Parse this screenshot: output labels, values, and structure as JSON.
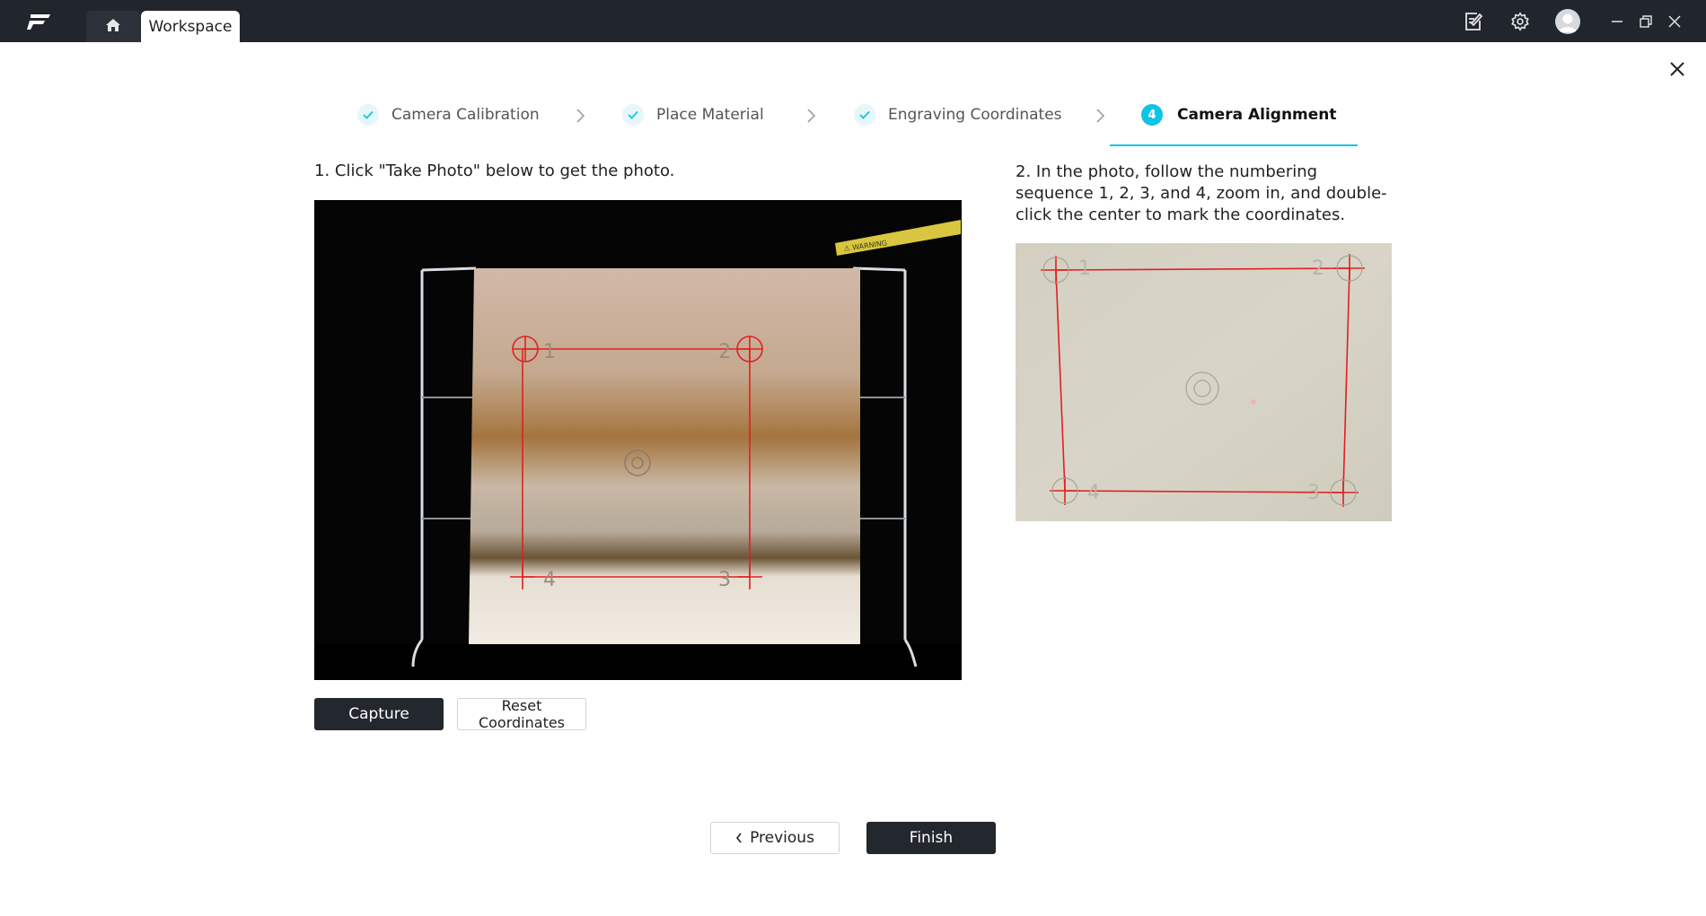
{
  "app": {
    "logo_icon": "f-logo-icon",
    "home_icon": "home-icon",
    "tab_label": "Workspace"
  },
  "titlebar_icons": [
    "notes-edit-icon",
    "gear-icon",
    "avatar-icon",
    "minimize-icon",
    "restore-icon",
    "close-icon"
  ],
  "stepper": {
    "steps": [
      {
        "label": "Camera Calibration",
        "state": "done"
      },
      {
        "label": "Place Material",
        "state": "done"
      },
      {
        "label": "Engraving Coordinates",
        "state": "done"
      },
      {
        "label": "Camera Alignment",
        "state": "active",
        "number": "4"
      }
    ],
    "accent_color": "#0ec4e3"
  },
  "main": {
    "instruction_1": "1. Click \"Take Photo\" below to get the photo.",
    "instruction_2": "2. In the photo, follow the numbering sequence 1, 2, 3, and 4, zoom in, and double-click the center to mark the coordinates.",
    "capture_label": "Capture",
    "reset_label": "Reset Coordinates",
    "photo_marker_numbers": [
      "1",
      "2",
      "3",
      "4"
    ],
    "warning_sticker": "⚠ WARNING"
  },
  "footer": {
    "previous_label": "Previous",
    "finish_label": "Finish"
  },
  "colors": {
    "titlebar": "#21252c",
    "dark_button": "#23272e",
    "marker_red": "#e02020"
  }
}
